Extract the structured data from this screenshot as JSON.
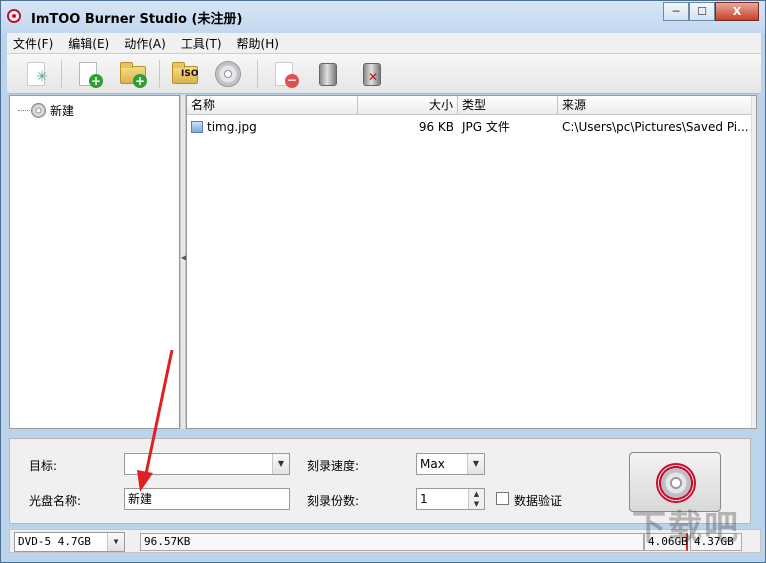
{
  "window": {
    "title": "ImTOO Burner Studio (未注册)",
    "controls": {
      "minimize": "─",
      "maximize": "☐",
      "close": "X"
    }
  },
  "menu": [
    "文件(F)",
    "编辑(E)",
    "动作(A)",
    "工具(T)",
    "帮助(H)"
  ],
  "toolbar": {
    "iso_label": "ISO",
    "icons": [
      "new-disc-icon",
      "add-file-icon",
      "add-folder-icon",
      "iso-icon",
      "disc-icon",
      "remove-icon",
      "clear-icon",
      "delete-icon"
    ]
  },
  "tree": {
    "root_label": "新建"
  },
  "file_list": {
    "columns": [
      "名称",
      "大小",
      "类型",
      "来源"
    ],
    "rows": [
      {
        "name": "timg.jpg",
        "size": "96 KB",
        "type": "JPG 文件",
        "source": "C:\\Users\\pc\\Pictures\\Saved Pi..."
      }
    ]
  },
  "settings": {
    "target_label": "目标:",
    "target_value": "",
    "disc_name_label": "光盘名称:",
    "disc_name_value": "新建",
    "speed_label": "刻录速度:",
    "speed_value": "Max",
    "copies_label": "刻录份数:",
    "copies_value": "1",
    "verify_label": "数据验证",
    "verify_checked": false
  },
  "status_bar": {
    "disc_type": "DVD-5 4.7GB",
    "used": "96.57KB",
    "marker_a": "4.06GB",
    "marker_b": "4.37GB"
  },
  "watermark": "下载吧",
  "colors": {
    "accent_red": "#c8102e",
    "annotation_arrow": "#e02020"
  }
}
